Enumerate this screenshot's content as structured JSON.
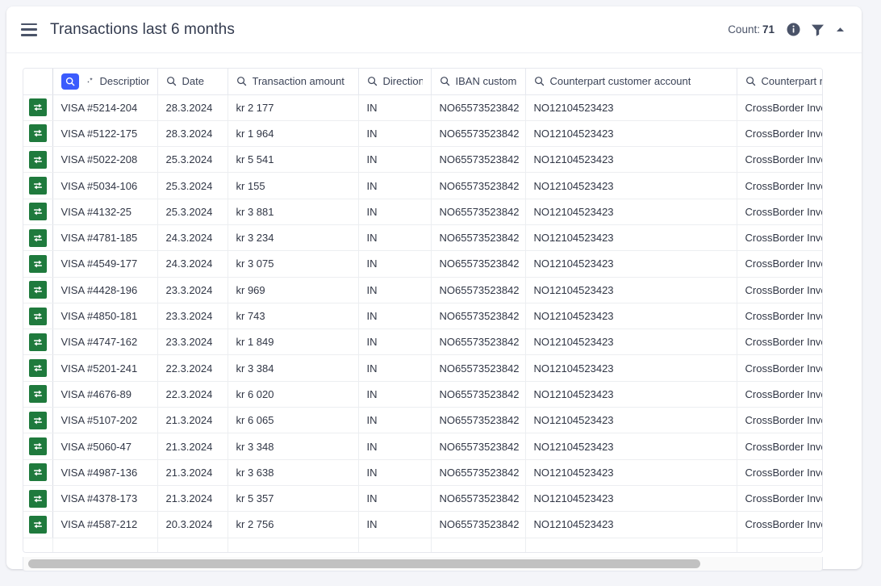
{
  "header": {
    "menu_icon": "hamburger-menu-icon",
    "title": "Transactions last 6 months",
    "count_label": "Count:",
    "count_value": "71",
    "info_icon": "info-icon",
    "filter_icon": "filter-icon",
    "collapse_icon": "chevron-up-icon"
  },
  "colors": {
    "page_bg": "#f4f5f9",
    "card_bg": "#ffffff",
    "accent_blue": "#3b5bfd",
    "badge_green": "#1f7a3d",
    "text": "#303645",
    "border": "#e6e8ee"
  },
  "table": {
    "columns": [
      {
        "key": "icon",
        "label": "",
        "search": false,
        "sparkle": false,
        "active_search": false
      },
      {
        "key": "description",
        "label": "Description",
        "search": true,
        "sparkle": true,
        "active_search": true
      },
      {
        "key": "date",
        "label": "Date",
        "search": true,
        "sparkle": false,
        "active_search": false
      },
      {
        "key": "amount",
        "label": "Transaction amount",
        "search": true,
        "sparkle": false,
        "active_search": false
      },
      {
        "key": "direction",
        "label": "Direction",
        "search": true,
        "sparkle": false,
        "active_search": false
      },
      {
        "key": "iban",
        "label": "IBAN customer",
        "search": true,
        "sparkle": false,
        "active_search": false
      },
      {
        "key": "counterpart_account",
        "label": "Counterpart customer account",
        "search": true,
        "sparkle": false,
        "active_search": false
      },
      {
        "key": "counterpart_name",
        "label": "Counterpart name",
        "search": true,
        "sparkle": false,
        "active_search": false
      }
    ],
    "row_icon": "transaction-transfer-icon",
    "rows": [
      {
        "description": "VISA #5214-204",
        "date": "28.3.2024",
        "amount": "kr 2 177",
        "direction": "IN",
        "iban": "NO65573523842",
        "counterpart_account": "NO12104523423",
        "counterpart_name": "CrossBorder Investments"
      },
      {
        "description": "VISA #5122-175",
        "date": "28.3.2024",
        "amount": "kr 1 964",
        "direction": "IN",
        "iban": "NO65573523842",
        "counterpart_account": "NO12104523423",
        "counterpart_name": "CrossBorder Investments"
      },
      {
        "description": "VISA #5022-208",
        "date": "25.3.2024",
        "amount": "kr 5 541",
        "direction": "IN",
        "iban": "NO65573523842",
        "counterpart_account": "NO12104523423",
        "counterpart_name": "CrossBorder Investments"
      },
      {
        "description": "VISA #5034-106",
        "date": "25.3.2024",
        "amount": "kr 155",
        "direction": "IN",
        "iban": "NO65573523842",
        "counterpart_account": "NO12104523423",
        "counterpart_name": "CrossBorder Investments"
      },
      {
        "description": "VISA #4132-25",
        "date": "25.3.2024",
        "amount": "kr 3 881",
        "direction": "IN",
        "iban": "NO65573523842",
        "counterpart_account": "NO12104523423",
        "counterpart_name": "CrossBorder Investments"
      },
      {
        "description": "VISA #4781-185",
        "date": "24.3.2024",
        "amount": "kr 3 234",
        "direction": "IN",
        "iban": "NO65573523842",
        "counterpart_account": "NO12104523423",
        "counterpart_name": "CrossBorder Investments"
      },
      {
        "description": "VISA #4549-177",
        "date": "24.3.2024",
        "amount": "kr 3 075",
        "direction": "IN",
        "iban": "NO65573523842",
        "counterpart_account": "NO12104523423",
        "counterpart_name": "CrossBorder Investments"
      },
      {
        "description": "VISA #4428-196",
        "date": "23.3.2024",
        "amount": "kr 969",
        "direction": "IN",
        "iban": "NO65573523842",
        "counterpart_account": "NO12104523423",
        "counterpart_name": "CrossBorder Investments"
      },
      {
        "description": "VISA #4850-181",
        "date": "23.3.2024",
        "amount": "kr 743",
        "direction": "IN",
        "iban": "NO65573523842",
        "counterpart_account": "NO12104523423",
        "counterpart_name": "CrossBorder Investments"
      },
      {
        "description": "VISA #4747-162",
        "date": "23.3.2024",
        "amount": "kr 1 849",
        "direction": "IN",
        "iban": "NO65573523842",
        "counterpart_account": "NO12104523423",
        "counterpart_name": "CrossBorder Investments"
      },
      {
        "description": "VISA #5201-241",
        "date": "22.3.2024",
        "amount": "kr 3 384",
        "direction": "IN",
        "iban": "NO65573523842",
        "counterpart_account": "NO12104523423",
        "counterpart_name": "CrossBorder Investments"
      },
      {
        "description": "VISA #4676-89",
        "date": "22.3.2024",
        "amount": "kr 6 020",
        "direction": "IN",
        "iban": "NO65573523842",
        "counterpart_account": "NO12104523423",
        "counterpart_name": "CrossBorder Investments"
      },
      {
        "description": "VISA #5107-202",
        "date": "21.3.2024",
        "amount": "kr 6 065",
        "direction": "IN",
        "iban": "NO65573523842",
        "counterpart_account": "NO12104523423",
        "counterpart_name": "CrossBorder Investments"
      },
      {
        "description": "VISA #5060-47",
        "date": "21.3.2024",
        "amount": "kr 3 348",
        "direction": "IN",
        "iban": "NO65573523842",
        "counterpart_account": "NO12104523423",
        "counterpart_name": "CrossBorder Investments"
      },
      {
        "description": "VISA #4987-136",
        "date": "21.3.2024",
        "amount": "kr 3 638",
        "direction": "IN",
        "iban": "NO65573523842",
        "counterpart_account": "NO12104523423",
        "counterpart_name": "CrossBorder Investments"
      },
      {
        "description": "VISA #4378-173",
        "date": "21.3.2024",
        "amount": "kr 5 357",
        "direction": "IN",
        "iban": "NO65573523842",
        "counterpart_account": "NO12104523423",
        "counterpart_name": "CrossBorder Investments"
      },
      {
        "description": "VISA #4587-212",
        "date": "20.3.2024",
        "amount": "kr 2 756",
        "direction": "IN",
        "iban": "NO65573523842",
        "counterpart_account": "NO12104523423",
        "counterpart_name": "CrossBorder Investments"
      }
    ]
  },
  "scrollbar": {
    "name": "horizontal-scrollbar"
  }
}
